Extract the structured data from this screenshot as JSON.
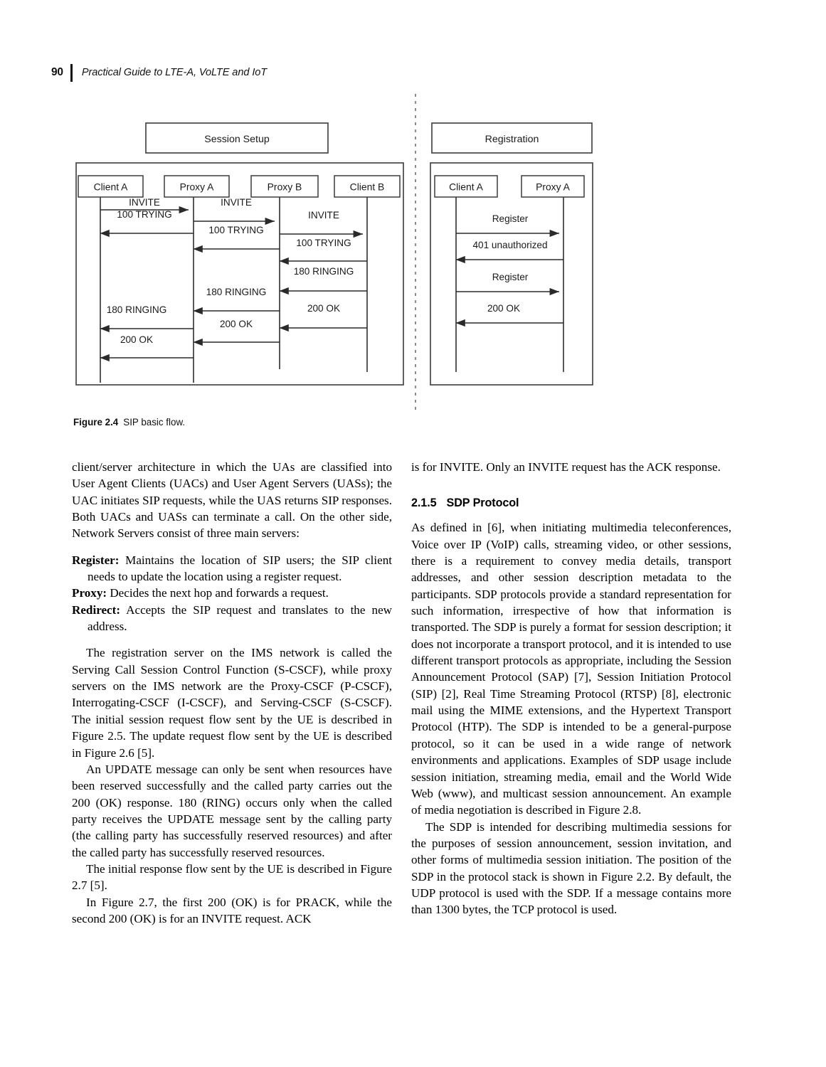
{
  "running_head": {
    "page_number": "90",
    "book_title": "Practical Guide to LTE-A, VoLTE and IoT"
  },
  "figure": {
    "caption_label": "Figure 2.4",
    "caption_text": "SIP basic flow.",
    "panels": [
      {
        "title": "Session Setup",
        "lifelines": [
          "Client A",
          "Proxy A",
          "Proxy B",
          "Client B"
        ],
        "messages": [
          {
            "label": "INVITE",
            "from": "Client A",
            "to": "Proxy A",
            "dir": "right"
          },
          {
            "label": "INVITE",
            "from": "Proxy A",
            "to": "Proxy B",
            "dir": "right"
          },
          {
            "label": "100 TRYING",
            "from": "Proxy A",
            "to": "Client A",
            "dir": "left"
          },
          {
            "label": "INVITE",
            "from": "Proxy B",
            "to": "Client B",
            "dir": "right"
          },
          {
            "label": "100 TRYING",
            "from": "Proxy B",
            "to": "Proxy A",
            "dir": "left"
          },
          {
            "label": "100 TRYING",
            "from": "Client B",
            "to": "Proxy B",
            "dir": "left"
          },
          {
            "label": "180 RINGING",
            "from": "Client B",
            "to": "Proxy B",
            "dir": "left"
          },
          {
            "label": "180 RINGING",
            "from": "Proxy B",
            "to": "Proxy A",
            "dir": "left"
          },
          {
            "label": "180 RINGING",
            "from": "Proxy A",
            "to": "Client A",
            "dir": "left"
          },
          {
            "label": "200 OK",
            "from": "Client B",
            "to": "Proxy B",
            "dir": "left"
          },
          {
            "label": "200 OK",
            "from": "Proxy B",
            "to": "Proxy A",
            "dir": "left"
          },
          {
            "label": "200 OK",
            "from": "Proxy A",
            "to": "Client A",
            "dir": "left"
          }
        ]
      },
      {
        "title": "Registration",
        "lifelines": [
          "Client A",
          "Proxy A"
        ],
        "messages": [
          {
            "label": "Register",
            "from": "Client A",
            "to": "Proxy A",
            "dir": "right"
          },
          {
            "label": "401 unauthorized",
            "from": "Proxy A",
            "to": "Client A",
            "dir": "left"
          },
          {
            "label": "Register",
            "from": "Client A",
            "to": "Proxy A",
            "dir": "right"
          },
          {
            "label": "200 OK",
            "from": "Proxy A",
            "to": "Client A",
            "dir": "left"
          }
        ]
      }
    ]
  },
  "left_column": {
    "para_continued": "client/server architecture in which the UAs are classified into User Agent Clients (UACs) and User Agent Servers (UASs); the UAC initiates SIP requests, while the UAS returns SIP responses. Both UACs and UASs can terminate a call. On the other side, Network Servers consist of three main servers:",
    "definitions": [
      {
        "term": "Register:",
        "text": " Maintains the location of SIP users; the SIP client needs to update the location using a register request."
      },
      {
        "term": "Proxy:",
        "text": " Decides the next hop and forwards a request."
      },
      {
        "term": "Redirect:",
        "text": " Accepts the SIP request and translates to the new address."
      }
    ],
    "paragraphs": [
      "The registration server on the IMS network is called the Serving Call Session Control Function (S-CSCF), while proxy servers on the IMS network are the Proxy-CSCF (P-CSCF), Interrogating-CSCF (I-CSCF), and Serving-CSCF (S-CSCF). The initial session request flow sent by the UE is described in Figure 2.5. The update request flow sent by the UE is described in Figure 2.6 [5].",
      "An UPDATE message can only be sent when resources have been reserved successfully and the called party carries out the 200 (OK) response. 180 (RING) occurs only when the called party receives the UPDATE message sent by the calling party (the calling party has successfully reserved resources) and after the called party has successfully reserved resources.",
      "The initial response flow sent by the UE is described in Figure 2.7 [5].",
      "In Figure 2.7, the first 200 (OK) is for PRACK, while the second 200 (OK) is for an INVITE request. ACK"
    ]
  },
  "right_column": {
    "para_continued": "is for INVITE. Only an INVITE request has the ACK response.",
    "section": {
      "number": "2.1.5",
      "title": "SDP Protocol"
    },
    "paragraphs": [
      "As defined in [6], when initiating multimedia teleconferences, Voice over IP (VoIP) calls, streaming video, or other sessions, there is a requirement to convey media details, transport addresses, and other session description metadata to the participants. SDP protocols provide a standard representation for such information, irrespective of how that information is transported. The SDP is purely a format for session description; it does not incorporate a transport protocol, and it is intended to use different transport protocols as appropriate, including the Session Announcement Protocol (SAP) [7], Session Initiation Protocol (SIP) [2], Real Time Streaming Protocol (RTSP) [8], electronic mail using the MIME extensions, and the Hypertext Transport Protocol (HTP). The SDP is intended to be a general-purpose protocol, so it can be used in a wide range of network environments and applications. Examples of SDP usage include session initiation, streaming media, email and the World Wide Web (www), and multicast session announcement. An example of media negotiation is described in Figure 2.8.",
      "The SDP is intended for describing multimedia sessions for the purposes of session announcement, session invitation, and other forms of multimedia session initiation. The position of the SDP in the protocol stack is shown in Figure 2.2. By default, the UDP protocol is used with the SDP. If a message contains more than 1300 bytes, the TCP protocol is used."
    ]
  }
}
